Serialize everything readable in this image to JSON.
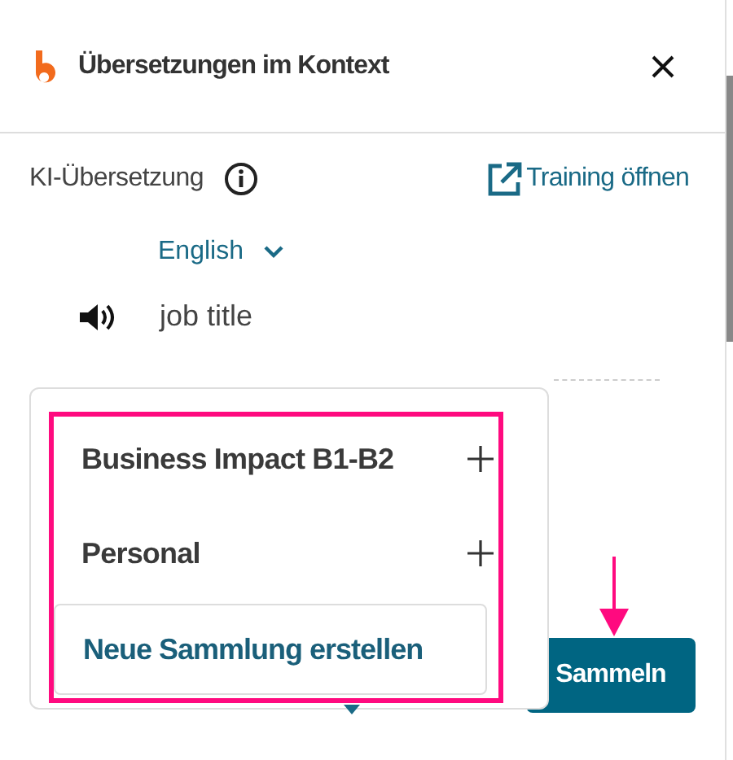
{
  "header": {
    "title": "Übersetzungen im Kontext"
  },
  "translation": {
    "label": "KI-Übersetzung",
    "training_link": "Training öffnen",
    "language": "English",
    "term": "job title"
  },
  "collect_button": "Sammeln",
  "dropdown": {
    "items": [
      {
        "label": "Business Impact B1-B2"
      },
      {
        "label": "Personal"
      }
    ],
    "create_button": "Neue Sammlung erstellen"
  }
}
